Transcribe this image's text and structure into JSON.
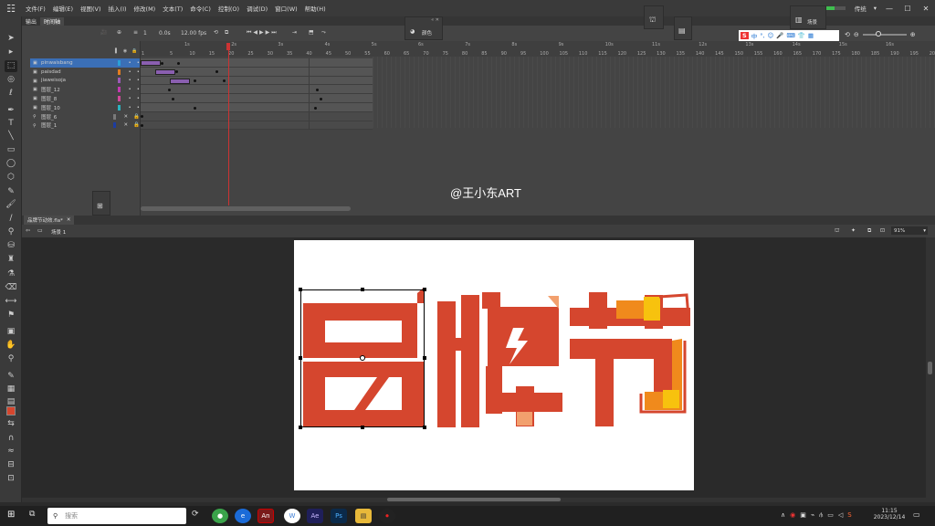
{
  "menubar": {
    "items": [
      "文件(F)",
      "编辑(E)",
      "视图(V)",
      "插入(I)",
      "修改(M)",
      "文本(T)",
      "命令(C)",
      "控制(O)",
      "调试(D)",
      "窗口(W)",
      "帮助(H)"
    ],
    "workspace": "传统"
  },
  "timeline_tabs": [
    "输出",
    "时间轴"
  ],
  "timeline": {
    "fps": "12.00 fps",
    "frame": "1",
    "time": "0.0s",
    "ruler": [
      "1s",
      "2s",
      "3s",
      "4s",
      "5s",
      "6s",
      "7s",
      "8s",
      "9s",
      "10s",
      "11s",
      "12s",
      "13s",
      "14s",
      "15s",
      "16s"
    ],
    "frame_numbers": [
      "1",
      "5",
      "10",
      "15",
      "20",
      "25",
      "30",
      "35",
      "40",
      "45",
      "50",
      "55",
      "60",
      "65",
      "70",
      "75",
      "80",
      "85",
      "90",
      "95",
      "100",
      "105",
      "110",
      "115",
      "120",
      "125",
      "130",
      "135",
      "140",
      "145",
      "150",
      "155",
      "160",
      "165",
      "170",
      "175",
      "180",
      "185",
      "190",
      "195",
      "200"
    ],
    "layers": [
      "pinwaisbang",
      "paisdad",
      "jiaweisoja",
      "图层_12",
      "图层_8",
      "图层_10",
      "图层_6",
      "图层_1"
    ]
  },
  "panels": {
    "color_label": "颜色",
    "scene_label": "场景"
  },
  "watermark": "@王小东ART",
  "document": {
    "tab": "品牌节动效.fla*",
    "scene": "场景 1",
    "zoom": "91%"
  },
  "artwork": {
    "text": "品牌节",
    "colors": {
      "main": "#d5462e",
      "orange": "#f08a1c",
      "yellow": "#f7c20e",
      "light": "#f2a06e"
    }
  },
  "taskbar": {
    "search_placeholder": "搜索",
    "time": "11:15",
    "date": "2023/12/14",
    "apps": [
      "Ae",
      "Ps"
    ]
  }
}
